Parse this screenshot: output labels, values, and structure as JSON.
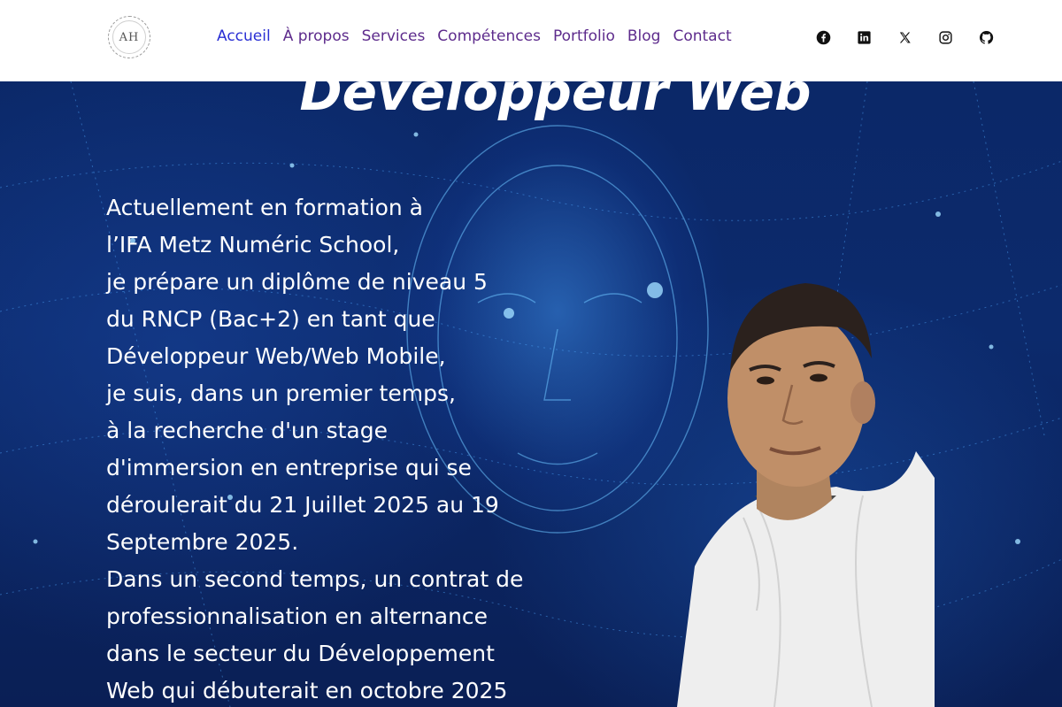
{
  "header": {
    "logo_text": "AH",
    "nav": [
      {
        "label": "Accueil",
        "active": true
      },
      {
        "label": "À propos",
        "active": false
      },
      {
        "label": "Services",
        "active": false
      },
      {
        "label": "Compétences",
        "active": false
      },
      {
        "label": "Portfolio",
        "active": false
      },
      {
        "label": "Blog",
        "active": false
      },
      {
        "label": "Contact",
        "active": false
      }
    ],
    "socials": [
      "facebook-icon",
      "linkedin-icon",
      "x-icon",
      "instagram-icon",
      "github-icon"
    ]
  },
  "hero": {
    "title": "Développeur Web",
    "lines": [
      "Actuellement en formation à",
      "l’IFA Metz Numéric School,",
      "je prépare un diplôme de niveau 5",
      "du RNCP (Bac+2) en tant que",
      "Développeur Web/Web Mobile,",
      "je suis, dans un premier temps,",
      "à la recherche d'un stage",
      "d'immersion en entreprise qui se",
      "déroulerait du 21 Juillet 2025 au 19",
      "Septembre 2025.",
      "Dans un second temps, un contrat de",
      "professionnalisation en alternance",
      "dans le secteur du Développement",
      "Web qui débuterait en octobre 2025"
    ]
  },
  "colors": {
    "nav_active": "#2a2fd4",
    "nav_link": "#5d2b8c",
    "hero_bg": "#0b2868"
  }
}
